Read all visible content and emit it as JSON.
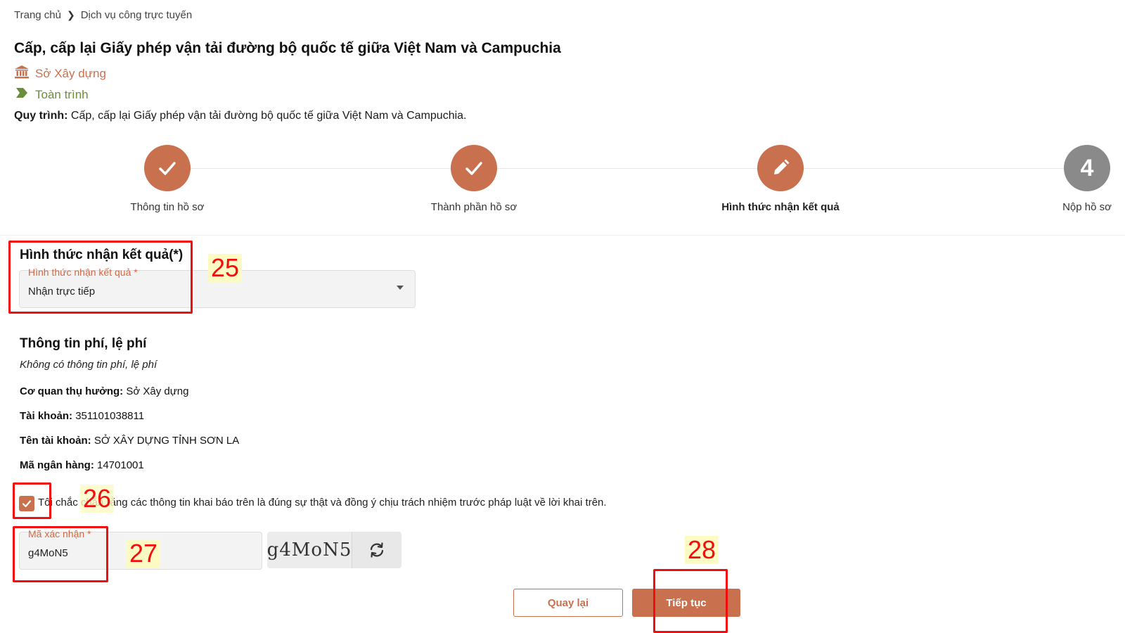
{
  "breadcrumb": {
    "home": "Trang chủ",
    "current": "Dịch vụ công trực tuyến"
  },
  "title": "Cấp, cấp lại Giấy phép vận tải đường bộ quốc tế giữa Việt Nam và Campuchia",
  "agency": "Sở Xây dựng",
  "scope": "Toàn trình",
  "process": {
    "label": "Quy trình:",
    "text": "Cấp, cấp lại Giấy phép vận tải đường bộ quốc tế giữa Việt Nam và Campuchia."
  },
  "steps": [
    {
      "label": "Thông tin hồ sơ",
      "state": "done"
    },
    {
      "label": "Thành phần hồ sơ",
      "state": "done"
    },
    {
      "label": "Hình thức nhận kết quả",
      "state": "active"
    },
    {
      "label": "Nộp hồ sơ",
      "state": "todo",
      "number": "4"
    }
  ],
  "result_method": {
    "heading": "Hình thức nhận kết quả(*)",
    "field_label": "Hình thức nhận kết quả *",
    "value": "Nhận trực tiếp"
  },
  "fee": {
    "heading": "Thông tin phí, lệ phí",
    "empty": "Không có thông tin phí, lệ phí",
    "rows": [
      {
        "label": "Cơ quan thụ hưởng:",
        "value": "Sở Xây dựng"
      },
      {
        "label": "Tài khoản:",
        "value": "351101038811"
      },
      {
        "label": "Tên tài khoản:",
        "value": "SỞ XÂY DỰNG TỈNH SƠN LA"
      },
      {
        "label": "Mã ngân hàng:",
        "value": "14701001"
      }
    ]
  },
  "agreement": {
    "checked": true,
    "text": "Tôi chắc chắn rằng các thông tin khai báo trên là đúng sự thật và đồng ý chịu trách nhiệm trước pháp luật về lời khai trên."
  },
  "captcha": {
    "field_label": "Mã xác nhận *",
    "value": "g4MoN5",
    "image_text": "g4MoN5"
  },
  "buttons": {
    "back": "Quay lại",
    "next": "Tiếp tục"
  },
  "annotations": [
    "25",
    "26",
    "27",
    "28"
  ],
  "colors": {
    "accent": "#c9704f",
    "scope_green": "#6b8e3a",
    "annotation_red": "#f00e0e",
    "pending_gray": "#8a8a8a"
  }
}
